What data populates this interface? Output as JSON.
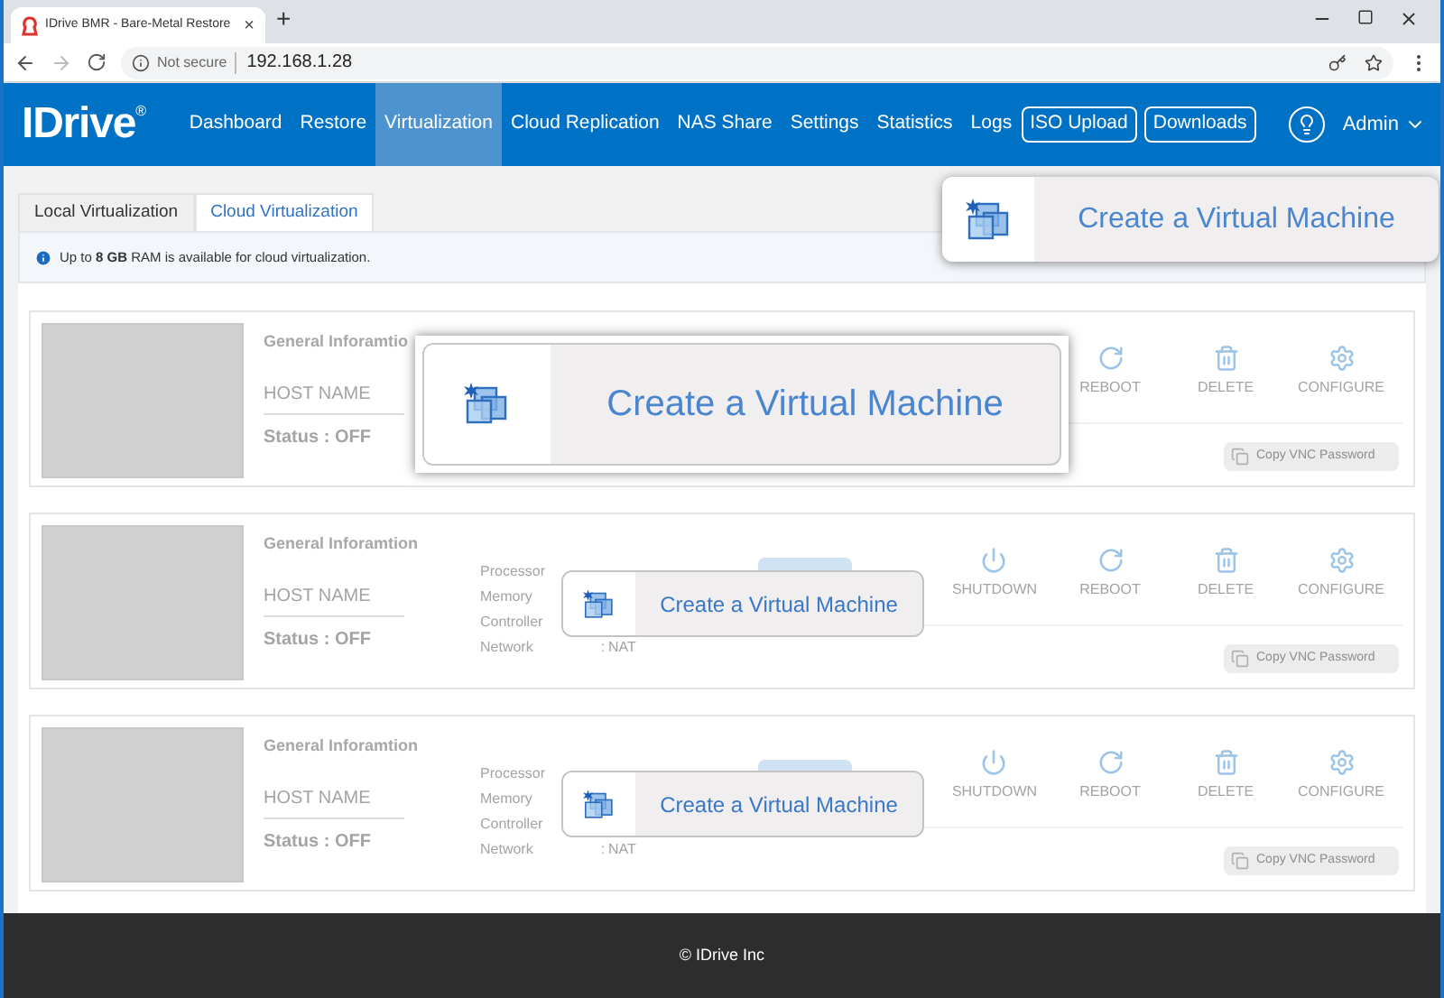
{
  "browser": {
    "tab_title": "IDrive BMR - Bare-Metal Restore",
    "tab_close": "×",
    "new_tab": "+",
    "security": "Not secure",
    "url": "192.168.1.28"
  },
  "nav": {
    "logo": "IDrive",
    "logo_mark": "®",
    "items": [
      {
        "label": "Dashboard",
        "selected": false
      },
      {
        "label": "Restore",
        "selected": false
      },
      {
        "label": "Virtualization",
        "selected": true
      },
      {
        "label": "Cloud Replication",
        "selected": false
      },
      {
        "label": "NAS Share",
        "selected": false
      },
      {
        "label": "Settings",
        "selected": false
      },
      {
        "label": "Statistics",
        "selected": false
      },
      {
        "label": "Logs",
        "selected": false
      }
    ],
    "buttons": [
      "ISO Upload",
      "Downloads"
    ],
    "user": "Admin"
  },
  "tabs": [
    {
      "label": "Local Virtualization",
      "selected": false
    },
    {
      "label": "Cloud Virtualization",
      "selected": true
    }
  ],
  "notice": "Up to **8 GB** RAM is available for cloud virtualization.",
  "machines": [
    {
      "heading": "General Inforamtio",
      "host_placeholder": "HOST NAME",
      "status": "Status : OFF",
      "actions": [
        {
          "kind": "reboot",
          "label": "REBOOT"
        },
        {
          "kind": "delete",
          "label": "DELETE"
        },
        {
          "kind": "configure",
          "label": "CONFIGURE"
        }
      ],
      "vnc_button": "Copy VNC Password"
    },
    {
      "heading": "General Inforamtion",
      "host_placeholder": "HOST NAME",
      "status": "Status : OFF",
      "specs": [
        {
          "label": "Processor"
        },
        {
          "label": "Memory"
        },
        {
          "label": "Controller"
        },
        {
          "label": "Network",
          "separator": ":",
          "value": "NAT"
        }
      ],
      "actions": [
        {
          "kind": "shutdown",
          "label": "SHUTDOWN"
        },
        {
          "kind": "reboot",
          "label": "REBOOT"
        },
        {
          "kind": "delete",
          "label": "DELETE"
        },
        {
          "kind": "configure",
          "label": "CONFIGURE"
        }
      ],
      "vnc_button": "Copy VNC Password"
    },
    {
      "heading": "General Inforamtion",
      "host_placeholder": "HOST NAME",
      "status": "Status : OFF",
      "specs": [
        {
          "label": "Processor"
        },
        {
          "label": "Memory"
        },
        {
          "label": "Controller"
        },
        {
          "label": "Network",
          "separator": ":",
          "value": "NAT"
        }
      ],
      "actions": [
        {
          "kind": "shutdown",
          "label": "SHUTDOWN"
        },
        {
          "kind": "reboot",
          "label": "REBOOT"
        },
        {
          "kind": "delete",
          "label": "DELETE"
        },
        {
          "kind": "configure",
          "label": "CONFIGURE"
        }
      ],
      "vnc_button": "Copy VNC Password"
    }
  ],
  "callouts": [
    {
      "kind": "header",
      "label": "Create a Virtual Machine"
    },
    {
      "kind": "focus",
      "label": "Create a Virtual Machine"
    },
    {
      "kind": "inline",
      "label": "Create a Virtual Machine"
    },
    {
      "kind": "inline",
      "label": "Create a Virtual Machine"
    }
  ],
  "footer": "© IDrive Inc"
}
